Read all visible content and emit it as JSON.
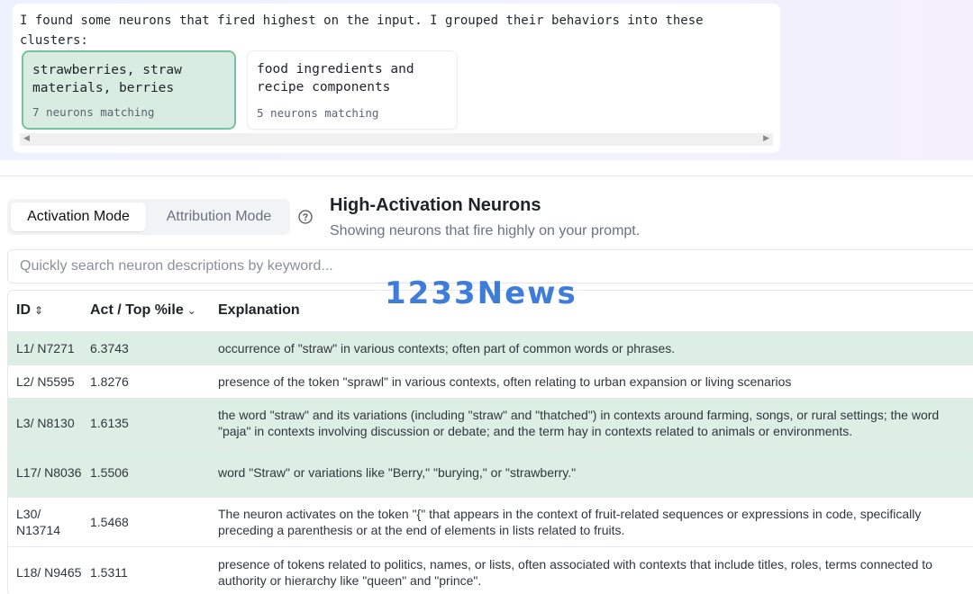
{
  "message": {
    "text": "I found some neurons that fired highest on the input. I grouped their behaviors into these clusters:",
    "clusters": [
      {
        "title": "strawberries, straw materials, berries",
        "count": "7 neurons matching"
      },
      {
        "title": "food ingredients and recipe components",
        "count": "5 neurons matching"
      }
    ]
  },
  "modes": {
    "activation": "Activation Mode",
    "attribution": "Attribution Mode"
  },
  "section": {
    "title": "High-Activation Neurons",
    "subtitle": "Showing neurons that fire highly on your prompt."
  },
  "search": {
    "placeholder": "Quickly search neuron descriptions by keyword..."
  },
  "table": {
    "headers": {
      "id": "ID",
      "act": "Act / Top %ile",
      "explanation": "Explanation"
    },
    "rows": [
      {
        "id": "L1/ N7271",
        "act": "6.3743",
        "explanation": "occurrence of \"straw\" in various contexts; often part of common words or phrases.",
        "highlight": true
      },
      {
        "id": "L2/ N5595",
        "act": "1.8276",
        "explanation": "presence of the token \"sprawl\" in various contexts, often relating to urban expansion or living scenarios",
        "highlight": false
      },
      {
        "id": "L3/ N8130",
        "act": "1.6135",
        "explanation": "the word \"straw\" and its variations (including \"straw\" and \"thatched\") in contexts around farming, songs, or rural settings; the word \"paja\" in contexts involving discussion or debate; and the term hay in contexts related to animals or environments.",
        "highlight": true
      },
      {
        "id": "L17/ N8036",
        "act": "1.5506",
        "explanation": "word \"Straw\" or variations like \"Berry,\" \"burying,\" or \"strawberry.\"",
        "highlight": true
      },
      {
        "id": "L30/ N13714",
        "act": "1.5468",
        "explanation": "The neuron activates on the token \"{\" that appears in the context of fruit-related sequences or expressions in code, specifically preceding a parenthesis or at the end of elements in lists related to fruits.",
        "highlight": false
      },
      {
        "id": "L18/ N9465",
        "act": "1.5311",
        "explanation": "presence of tokens related to politics, names, or lists, often associated with contexts that include titles, roles, terms connected to authority or hierarchy like \"queen\" and \"prince\".",
        "highlight": false
      }
    ]
  },
  "watermark": "1233News",
  "colors": {
    "highlight_row": "#ddeee5",
    "selected_cluster": "#d9ece2",
    "selected_cluster_border": "#79c0a0",
    "watermark": "#2b6fd6"
  },
  "icons": {
    "help": "question-circle-icon",
    "sort_id": "sort-updown-icon",
    "sort_act": "chevron-down-icon"
  }
}
